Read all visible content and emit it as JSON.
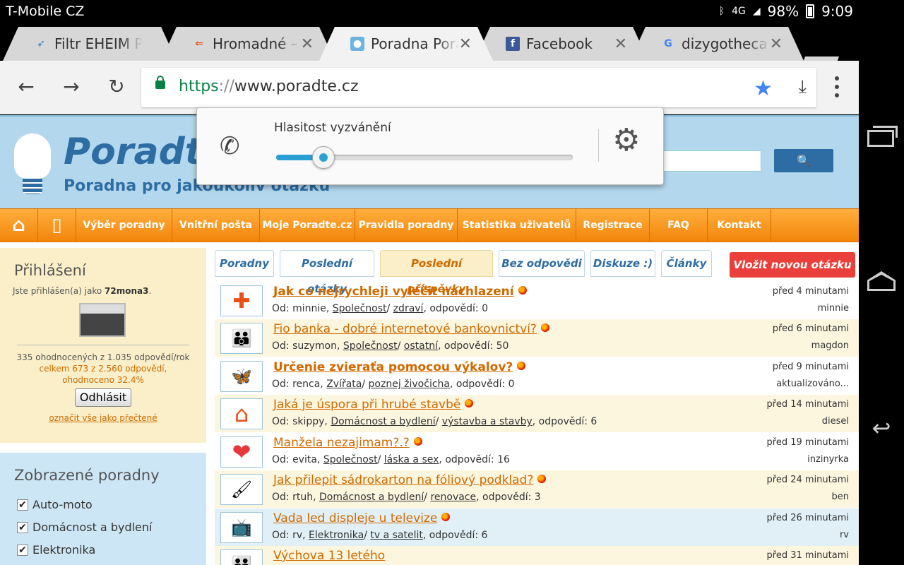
{
  "status": {
    "carrier": "T-Mobile CZ",
    "network": "4G",
    "battery": "98%",
    "time": "9:09",
    "bluetooth_icon": "bluetooth-icon",
    "signal_icon": "signal-icon"
  },
  "tabs": [
    {
      "title": "Filtr EHEIM Pick",
      "favicon": "bird-icon",
      "close": ""
    },
    {
      "title": "Hromadné – Se",
      "favicon": "arrow-icon",
      "close": "✕"
    },
    {
      "title": "Poradna Poradte.cz",
      "favicon": "bulb-icon",
      "close": "✕"
    },
    {
      "title": "Facebook",
      "favicon": "facebook-icon",
      "close": "✕"
    },
    {
      "title": "dizygotheca - Hledat Googlem",
      "favicon": "google-icon",
      "close": "✕"
    }
  ],
  "toolbar": {
    "url_proto": "https",
    "url_sep": "://",
    "url_host": "www.poradte.cz"
  },
  "site": {
    "logo": "Poradte.cz",
    "slogan": "Poradna pro jakoukoliv otázku"
  },
  "nav": [
    "Výběr poradny",
    "Vnitřní pošta",
    "Moje Poradte.cz",
    "Pravidla poradny",
    "Statistika uživatelů",
    "Registrace",
    "FAQ",
    "Kontakt"
  ],
  "login": {
    "title": "Přihlášení",
    "logged_prefix": "Jste přihlášen(a) jako",
    "user": "72mona3",
    "stat1": "335 ohodnocených z 1.035 odpovědí/rok",
    "stat2": "celkem 673 z 2.560 odpovědí,",
    "stat3": "ohodnoceno 32.4%",
    "logout": "Odhlásit",
    "mark_read": "označit vše jako přečtené"
  },
  "shown": {
    "title": "Zobrazené poradny",
    "items": [
      "Auto-moto",
      "Domácnost a bydlení",
      "Elektronika"
    ]
  },
  "content_tabs": [
    "Poradny",
    "Poslední otázky",
    "Poslední příspěvky",
    "Bez odpovědi",
    "Diskuze :)",
    "Články"
  ],
  "new_question": "Vložit novou otázku",
  "questions": [
    {
      "title": "Jak co nejrychleji vyléčit nachlazení",
      "from": "Od: minnie,",
      "cat": "Společnost",
      "sub": "zdraví",
      "answers": ", odpovědí: 0",
      "time": "před 4 minutami",
      "user": "minnie",
      "icon": "health-icon",
      "glyph": "✚"
    },
    {
      "title": "Fio banka - dobré internetové bankovnictví?",
      "from": "Od: suzymon,",
      "cat": "Společnost",
      "sub": "ostatní",
      "answers": ", odpovědí: 50",
      "time": "před 6 minutami",
      "user": "magdon",
      "icon": "people-icon",
      "glyph": "👪"
    },
    {
      "title": "Určenie zvieraťa pomocou výkalov?",
      "from": "Od: renca,",
      "cat": "Zvířata",
      "sub": "poznej živočicha",
      "answers": ", odpovědí: 0",
      "time": "před 9 minutami",
      "user": "aktualizováno...",
      "icon": "butterfly-icon",
      "glyph": "🦋"
    },
    {
      "title": "Jaká je úspora při hrubé stavbě",
      "from": "Od: skippy,",
      "cat": "Domácnost a bydlení",
      "sub": "výstavba a stavby",
      "answers": ", odpovědí: 6",
      "time": "před 14 minutami",
      "user": "diesel",
      "icon": "house-icon",
      "glyph": "⌂"
    },
    {
      "title": "Manžela nezajimam?.?",
      "from": "Od: evita,",
      "cat": "Společnost",
      "sub": "láska a sex",
      "answers": ", odpovědí: 16",
      "time": "před 19 minutami",
      "user": "inzinyrka",
      "icon": "heart-icon",
      "glyph": "❤"
    },
    {
      "title": "Jak přilepit sádrokarton na fóliový podklad?",
      "from": "Od: rtuh,",
      "cat": "Domácnost a bydlení",
      "sub": "renovace",
      "answers": ", odpovědí: 3",
      "time": "před 24 minutami",
      "user": "ben",
      "icon": "paint-roller-icon",
      "glyph": "🖌"
    },
    {
      "title": "Vada led displeje u televize",
      "from": "Od: rv,",
      "cat": "Elektronika",
      "sub": "tv a satelit",
      "answers": ", odpovědí: 6",
      "time": "před 26 minutami",
      "user": "rv",
      "icon": "tv-icon",
      "glyph": "📺"
    },
    {
      "title": "Výchova 13 letého",
      "from": "",
      "cat": "",
      "sub": "",
      "answers": "",
      "time": "před 31 minutami",
      "user": "",
      "icon": "family-icon",
      "glyph": "👪"
    }
  ],
  "volume": {
    "label": "Hlasitost vyzvánění",
    "level_percent": 16
  },
  "colors": {
    "accent_orange": "#f3850a",
    "link_orange": "#d06a00",
    "brand_blue": "#2e6da4",
    "new_question_red": "#e9403c",
    "slider_blue": "#2a9fd6"
  }
}
